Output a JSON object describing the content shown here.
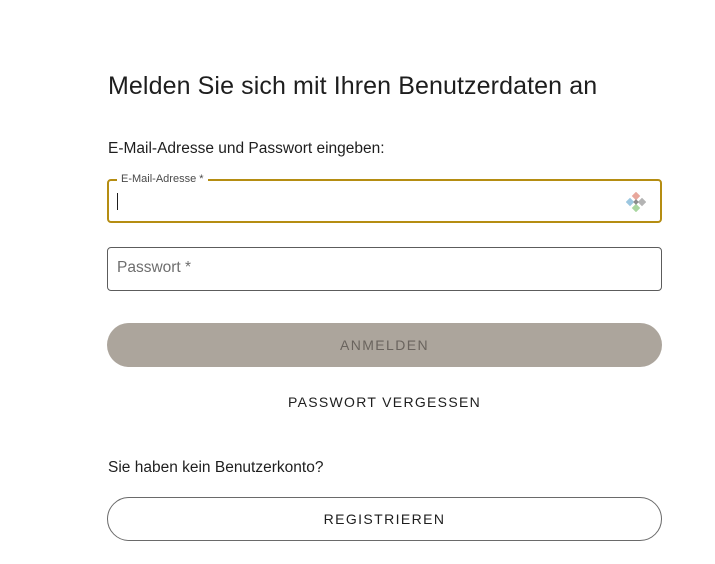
{
  "login": {
    "title": "Melden Sie sich mit Ihren Benutzerdaten an",
    "instruction": "E-Mail-Adresse und Passwort eingeben:",
    "email_field": {
      "label": "E-Mail-Adresse *",
      "value": "",
      "icon": "password-manager-autofill-icon"
    },
    "password_field": {
      "placeholder": "Passwort *",
      "value": ""
    },
    "submit_label": "ANMELDEN",
    "forgot_password_label": "PASSWORT VERGESSEN",
    "no_account_text": "Sie haben kein Benutzerkonto?",
    "register_label": "REGISTRIEREN"
  },
  "colors": {
    "focus_border": "#b58d12",
    "disabled_button": "#aca59c",
    "text": "#1e1e1e"
  }
}
